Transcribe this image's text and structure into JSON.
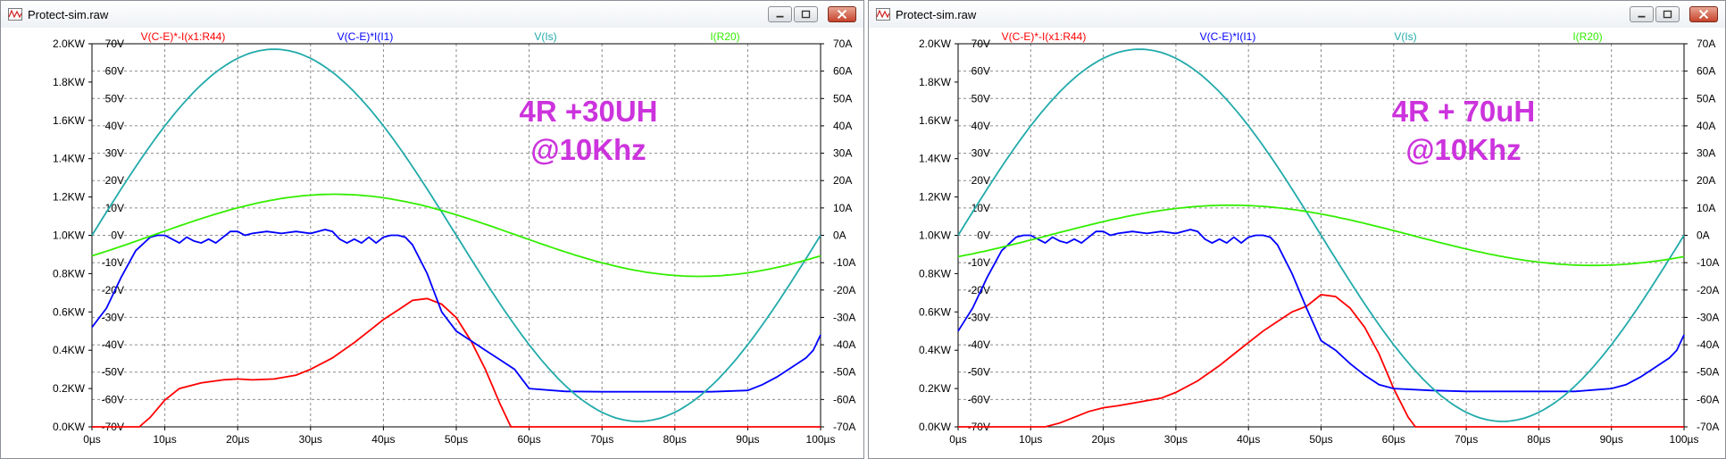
{
  "windows": [
    {
      "title": "Protect-sim.raw",
      "chart_data": {
        "type": "line",
        "annotation_line1": "4R +30UH",
        "annotation_line2": "@10Khz",
        "annotation_color": "#cc33dd",
        "x_ticks": [
          "0µs",
          "10µs",
          "20µs",
          "30µs",
          "40µs",
          "50µs",
          "60µs",
          "70µs",
          "80µs",
          "90µs",
          "100µs"
        ],
        "xlim": [
          0,
          100
        ],
        "left_ticks": [
          "0.0KW",
          "0.2KW",
          "0.4KW",
          "0.6KW",
          "0.8KW",
          "1.0KW",
          "1.2KW",
          "1.4KW",
          "1.6KW",
          "1.8KW",
          "2.0KW"
        ],
        "left_lim": [
          0,
          2.0
        ],
        "inner_ticks": [
          "-70V",
          "-60V",
          "-50V",
          "-40V",
          "-30V",
          "-20V",
          "-10V",
          "0V",
          "10V",
          "20V",
          "30V",
          "40V",
          "50V",
          "60V",
          "70V"
        ],
        "inner_lim": [
          -70,
          70
        ],
        "right_ticks": [
          "-70A",
          "-60A",
          "-50A",
          "-40A",
          "-30A",
          "-20A",
          "-10A",
          "0A",
          "10A",
          "20A",
          "30A",
          "40A",
          "50A",
          "60A",
          "70A"
        ],
        "right_lim": [
          -70,
          70
        ],
        "grid": true,
        "series": [
          {
            "name": "V(C-E)*-I(x1:R44)",
            "color": "#ff0000",
            "axis": "left",
            "x": [
              0,
              6.5,
              8,
              10,
              12,
              15,
              18,
              20,
              22,
              25,
              28,
              30,
              33,
              36,
              38,
              40,
              42,
              44,
              46,
              48,
              50,
              52,
              54,
              56,
              57.5,
              60,
              70,
              80,
              90,
              100
            ],
            "y": [
              0,
              0,
              0.05,
              0.14,
              0.2,
              0.23,
              0.245,
              0.25,
              0.245,
              0.25,
              0.27,
              0.3,
              0.36,
              0.44,
              0.5,
              0.56,
              0.61,
              0.66,
              0.67,
              0.64,
              0.57,
              0.45,
              0.3,
              0.12,
              0,
              0,
              0,
              0,
              0,
              0
            ]
          },
          {
            "name": "V(C-E)*I(I1)",
            "color": "#0000ff",
            "axis": "left",
            "x": [
              0,
              2,
              4,
              6,
              8,
              9,
              10,
              11,
              12,
              13,
              14,
              15,
              16,
              17,
              18,
              19,
              20,
              21,
              22,
              24,
              26,
              28,
              30,
              31,
              32,
              33,
              34,
              35,
              36,
              37,
              38,
              39,
              40,
              41,
              42,
              43,
              44,
              46,
              48,
              50,
              52,
              54,
              56,
              58,
              60,
              65,
              70,
              75,
              80,
              85,
              90,
              92,
              94,
              96,
              98,
              99,
              100
            ],
            "y": [
              0.52,
              0.62,
              0.78,
              0.92,
              0.99,
              1.0,
              1.0,
              0.98,
              0.96,
              0.99,
              0.97,
              0.96,
              0.98,
              0.96,
              0.99,
              1.02,
              1.02,
              1.0,
              1.01,
              1.02,
              1.01,
              1.02,
              1.01,
              1.02,
              1.03,
              1.02,
              0.98,
              0.96,
              0.98,
              0.96,
              0.99,
              0.96,
              0.99,
              1.0,
              1.0,
              0.99,
              0.95,
              0.8,
              0.6,
              0.5,
              0.45,
              0.4,
              0.35,
              0.3,
              0.2,
              0.185,
              0.183,
              0.183,
              0.183,
              0.183,
              0.19,
              0.22,
              0.26,
              0.31,
              0.36,
              0.4,
              0.48
            ]
          },
          {
            "name": "V(Is)",
            "color": "#22aaaa",
            "axis": "inner",
            "amplitude": 68,
            "offset": 0,
            "phase_deg": 0,
            "period_us": 100
          },
          {
            "name": "I(R20)",
            "color": "#33ee00",
            "axis": "inner",
            "amplitude": 15,
            "offset": 0,
            "phase_deg": -30,
            "period_us": 100
          }
        ]
      }
    },
    {
      "title": "Protect-sim.raw",
      "chart_data": {
        "type": "line",
        "annotation_line1": "4R + 70uH",
        "annotation_line2": "@10Khz",
        "annotation_color": "#cc33dd",
        "x_ticks": [
          "0µs",
          "10µs",
          "20µs",
          "30µs",
          "40µs",
          "50µs",
          "60µs",
          "70µs",
          "80µs",
          "90µs",
          "100µs"
        ],
        "xlim": [
          0,
          100
        ],
        "left_ticks": [
          "0.0KW",
          "0.2KW",
          "0.4KW",
          "0.6KW",
          "0.8KW",
          "1.0KW",
          "1.2KW",
          "1.4KW",
          "1.6KW",
          "1.8KW",
          "2.0KW"
        ],
        "left_lim": [
          0,
          2.0
        ],
        "inner_ticks": [
          "-70V",
          "-60V",
          "-50V",
          "-40V",
          "-30V",
          "-20V",
          "-10V",
          "0V",
          "10V",
          "20V",
          "30V",
          "40V",
          "50V",
          "60V",
          "70V"
        ],
        "inner_lim": [
          -70,
          70
        ],
        "right_ticks": [
          "-70A",
          "-60A",
          "-50A",
          "-40A",
          "-30A",
          "-20A",
          "-10A",
          "0A",
          "10A",
          "20A",
          "30A",
          "40A",
          "50A",
          "60A",
          "70A"
        ],
        "right_lim": [
          -70,
          70
        ],
        "grid": true,
        "series": [
          {
            "name": "V(C-E)*-I(x1:R44)",
            "color": "#ff0000",
            "axis": "left",
            "x": [
              0,
              12,
              14,
              16,
              18,
              20,
              22,
              25,
              28,
              30,
              33,
              36,
              38,
              40,
              42,
              44,
              46,
              48,
              50,
              52,
              54,
              56,
              58,
              60,
              62,
              63,
              65,
              70,
              80,
              90,
              100
            ],
            "y": [
              0,
              0,
              0.02,
              0.05,
              0.08,
              0.1,
              0.11,
              0.13,
              0.15,
              0.18,
              0.24,
              0.32,
              0.38,
              0.44,
              0.5,
              0.55,
              0.6,
              0.63,
              0.69,
              0.68,
              0.62,
              0.52,
              0.38,
              0.2,
              0.05,
              0,
              0,
              0,
              0,
              0,
              0
            ]
          },
          {
            "name": "V(C-E)*I(I1)",
            "color": "#0000ff",
            "axis": "left",
            "x": [
              0,
              2,
              4,
              6,
              8,
              9,
              10,
              11,
              12,
              13,
              14,
              15,
              16,
              17,
              18,
              19,
              20,
              21,
              22,
              24,
              26,
              28,
              30,
              31,
              32,
              33,
              34,
              35,
              36,
              37,
              38,
              39,
              40,
              41,
              42,
              43,
              44,
              46,
              48,
              50,
              52,
              54,
              56,
              58,
              60,
              65,
              70,
              75,
              80,
              85,
              90,
              92,
              94,
              96,
              98,
              99,
              100
            ],
            "y": [
              0.5,
              0.62,
              0.78,
              0.92,
              0.99,
              1.0,
              1.0,
              0.98,
              0.96,
              0.99,
              0.97,
              0.96,
              0.98,
              0.96,
              0.99,
              1.02,
              1.02,
              1.0,
              1.01,
              1.02,
              1.01,
              1.02,
              1.01,
              1.02,
              1.03,
              1.02,
              0.98,
              0.96,
              0.98,
              0.96,
              0.99,
              0.96,
              0.99,
              1.0,
              1.0,
              0.99,
              0.95,
              0.8,
              0.62,
              0.45,
              0.4,
              0.33,
              0.27,
              0.22,
              0.2,
              0.19,
              0.185,
              0.185,
              0.185,
              0.185,
              0.2,
              0.22,
              0.26,
              0.31,
              0.36,
              0.4,
              0.48
            ]
          },
          {
            "name": "V(Is)",
            "color": "#22aaaa",
            "axis": "inner",
            "amplitude": 68,
            "offset": 0,
            "phase_deg": 0,
            "period_us": 100
          },
          {
            "name": "I(R20)",
            "color": "#33ee00",
            "axis": "inner",
            "amplitude": 11,
            "offset": 0,
            "phase_deg": -45,
            "period_us": 100
          }
        ]
      }
    }
  ]
}
